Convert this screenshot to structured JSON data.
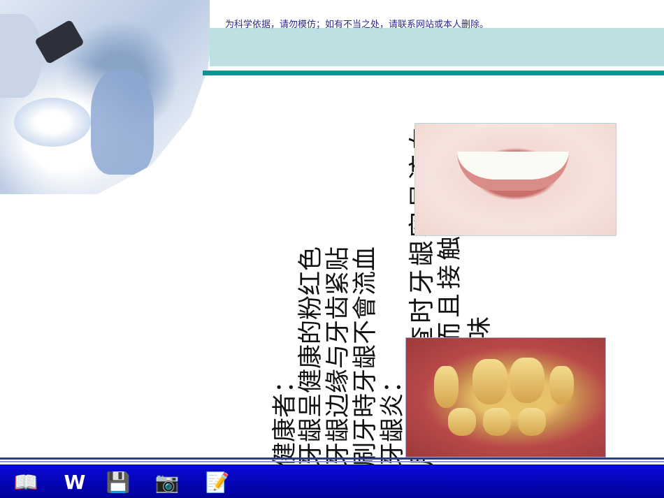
{
  "header": {
    "notice": "为科学依据，请勿模仿；如有不当之处，请联系网站或本人删除。"
  },
  "content": {
    "columns": [
      "健康者：",
      "牙龈呈健康的粉红色",
      "牙龈边缘与牙齿紧贴",
      "刷牙時牙龈不會流血",
      "牙龈炎：",
      "用探針检查时牙龈容易流血",
      "牙龈红肿而且接触",
      "口腔有气味"
    ]
  },
  "taskbar": {
    "icons": [
      "book-icon",
      "word-icon",
      "floppy-disk-icon",
      "camera-icon",
      "notes-icon"
    ]
  },
  "colors": {
    "header_band": "#bde0e3",
    "teal_stripe": "#0e9294",
    "taskbar": "#0a0ad8"
  }
}
